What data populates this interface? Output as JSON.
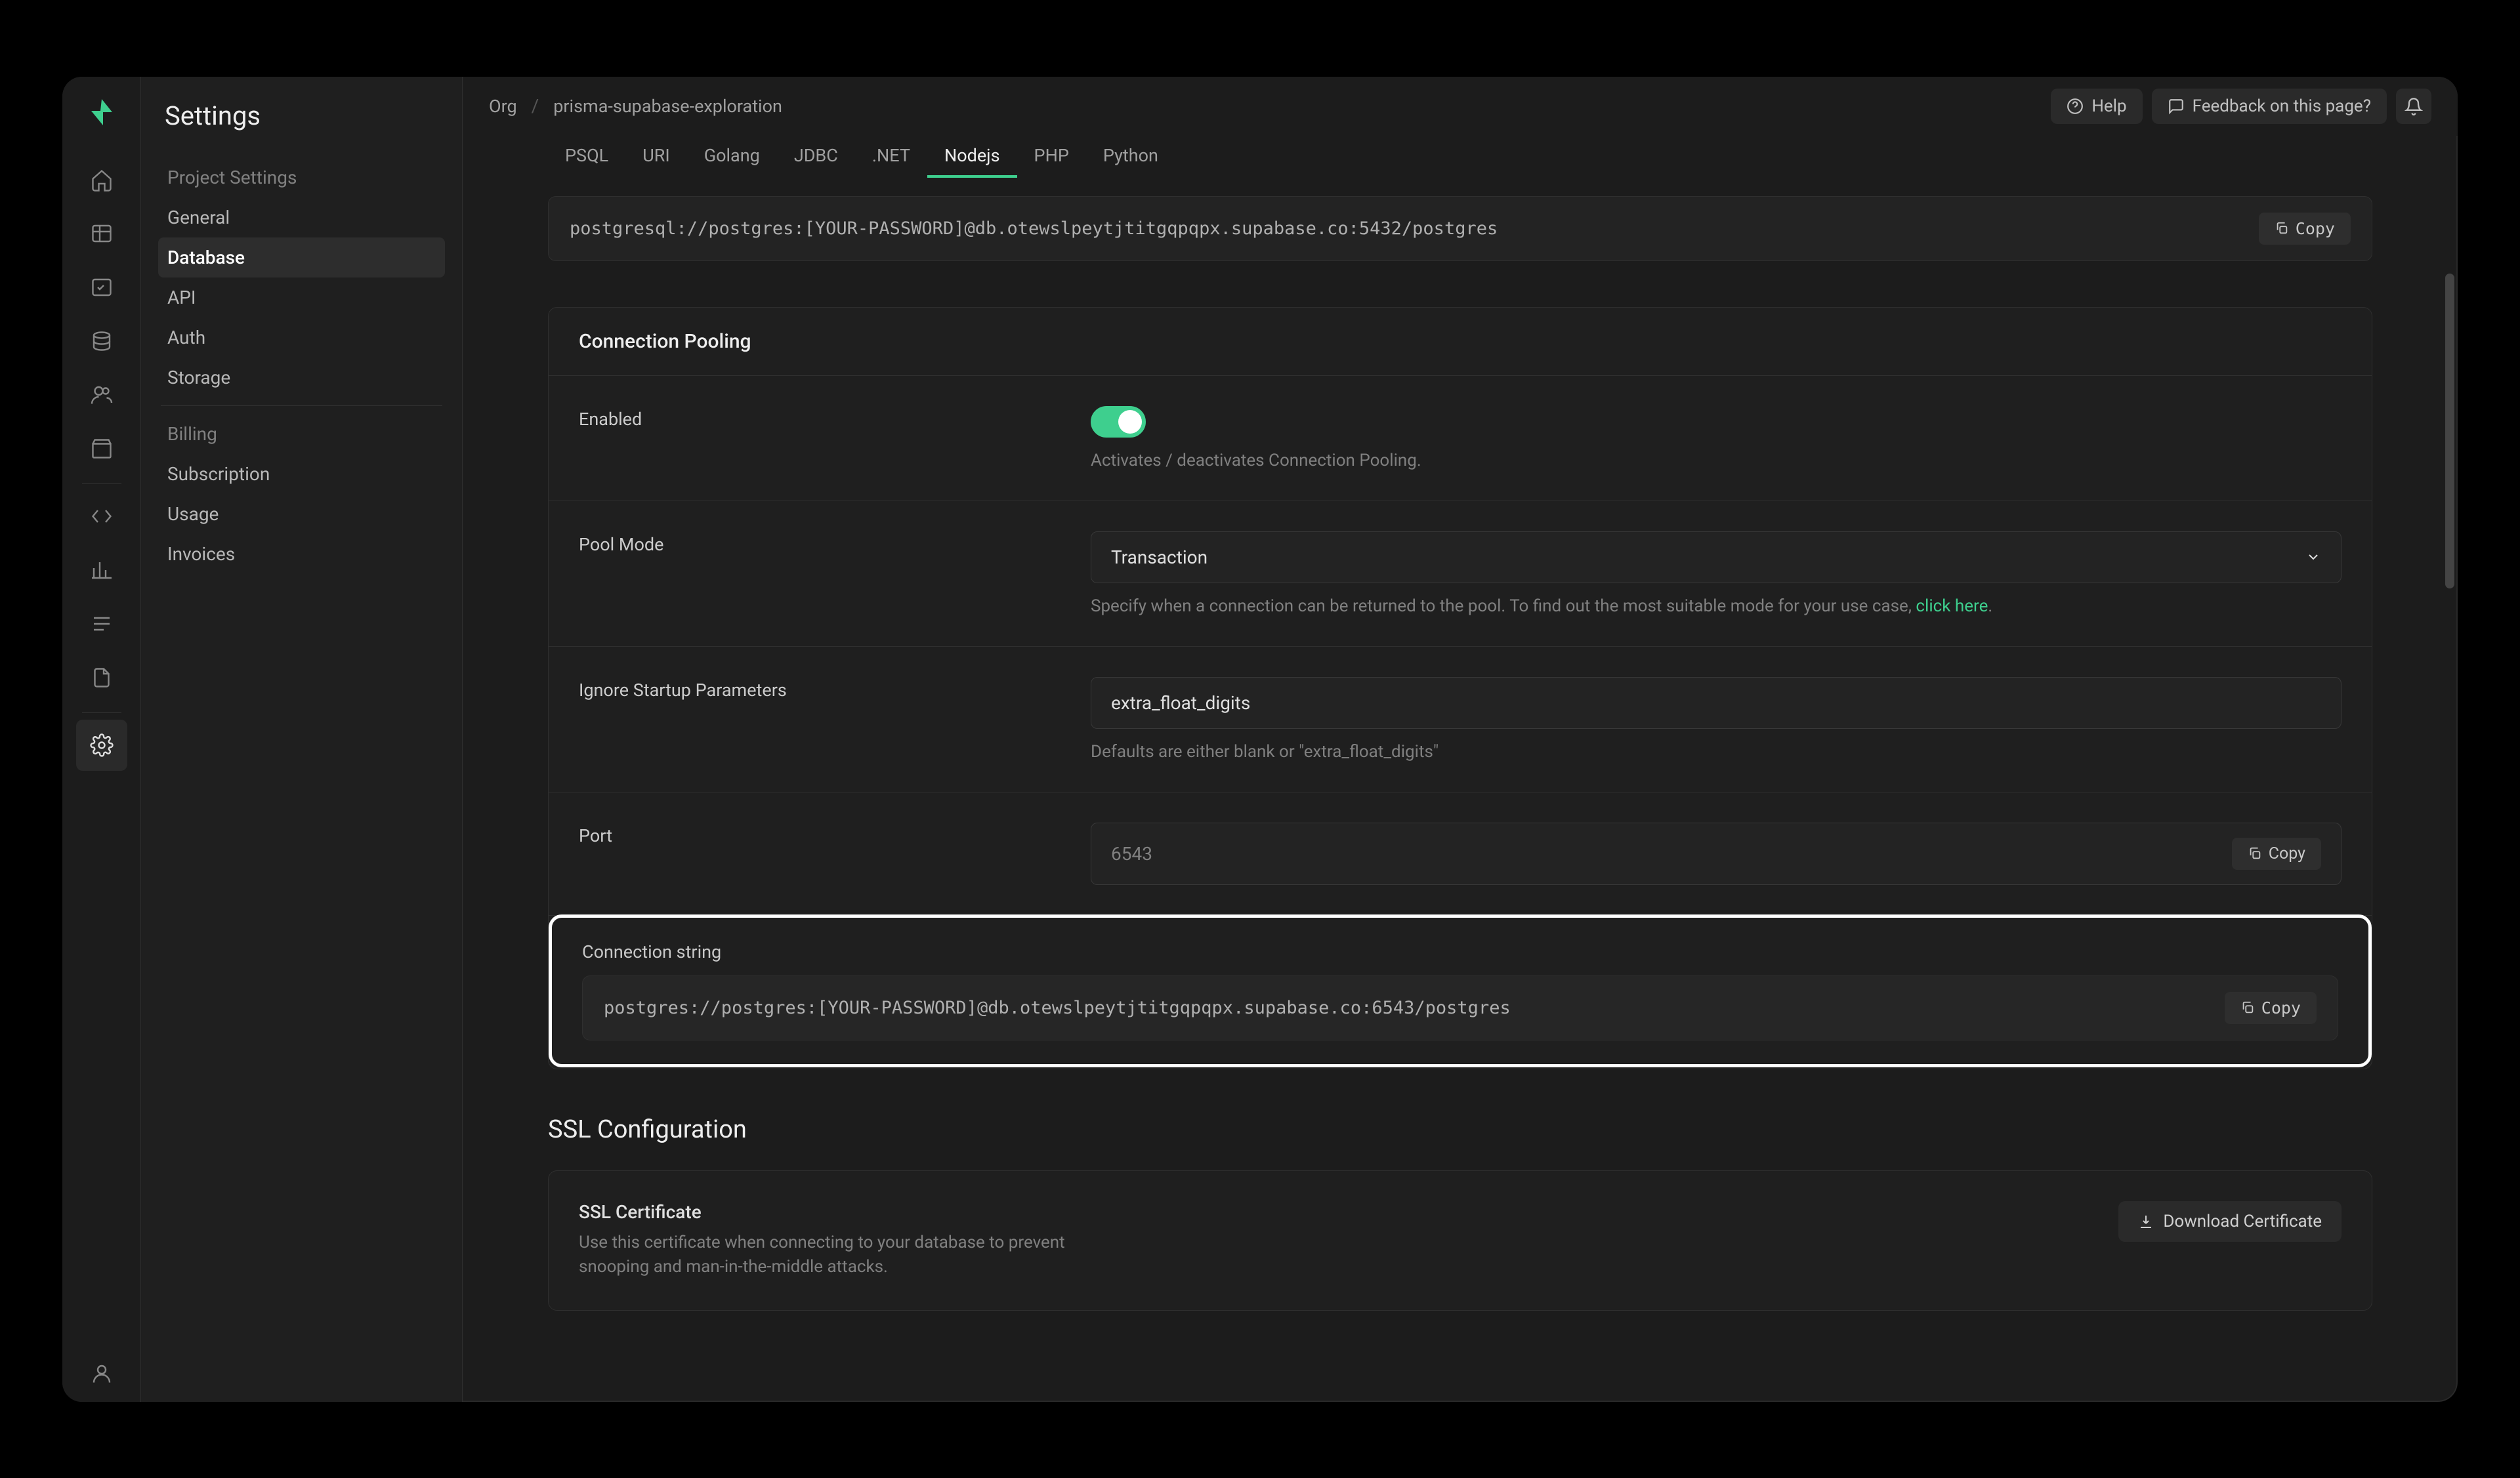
{
  "page_title": "Settings",
  "breadcrumb": {
    "root": "Org",
    "project": "prisma-supabase-exploration"
  },
  "topbar": {
    "help": "Help",
    "feedback": "Feedback on this page?"
  },
  "sidebar": {
    "groups": [
      {
        "label": "Project Settings",
        "items": [
          "General",
          "Database",
          "API",
          "Auth",
          "Storage"
        ],
        "active": "Database"
      },
      {
        "label": "Billing",
        "items": [
          "Subscription",
          "Usage",
          "Invoices"
        ]
      }
    ]
  },
  "connstr_tabs": [
    "PSQL",
    "URI",
    "Golang",
    "JDBC",
    ".NET",
    "Nodejs",
    "PHP",
    "Python"
  ],
  "connstr_active": "Nodejs",
  "connstr_value": "postgresql://postgres:[YOUR-PASSWORD]@db.otewslpeytjtitgqpqpx.supabase.co:5432/postgres",
  "copy_label": "Copy",
  "pooling": {
    "title": "Connection Pooling",
    "enabled_label": "Enabled",
    "enabled_help": "Activates / deactivates Connection Pooling.",
    "mode_label": "Pool Mode",
    "mode_value": "Transaction",
    "mode_help_pre": "Specify when a connection can be returned to the pool. To find out the most suitable mode for your use case, ",
    "mode_help_link": "click here",
    "startup_label": "Ignore Startup Parameters",
    "startup_value": "extra_float_digits",
    "startup_help": "Defaults are either blank or \"extra_float_digits\"",
    "port_label": "Port",
    "port_value": "6543",
    "cs_label": "Connection string",
    "cs_value": "postgres://postgres:[YOUR-PASSWORD]@db.otewslpeytjtitgqpqpx.supabase.co:6543/postgres"
  },
  "ssl": {
    "title": "SSL Configuration",
    "cert_title": "SSL Certificate",
    "cert_desc": "Use this certificate when connecting to your database to prevent snooping and man-in-the-middle attacks.",
    "download": "Download Certificate"
  }
}
